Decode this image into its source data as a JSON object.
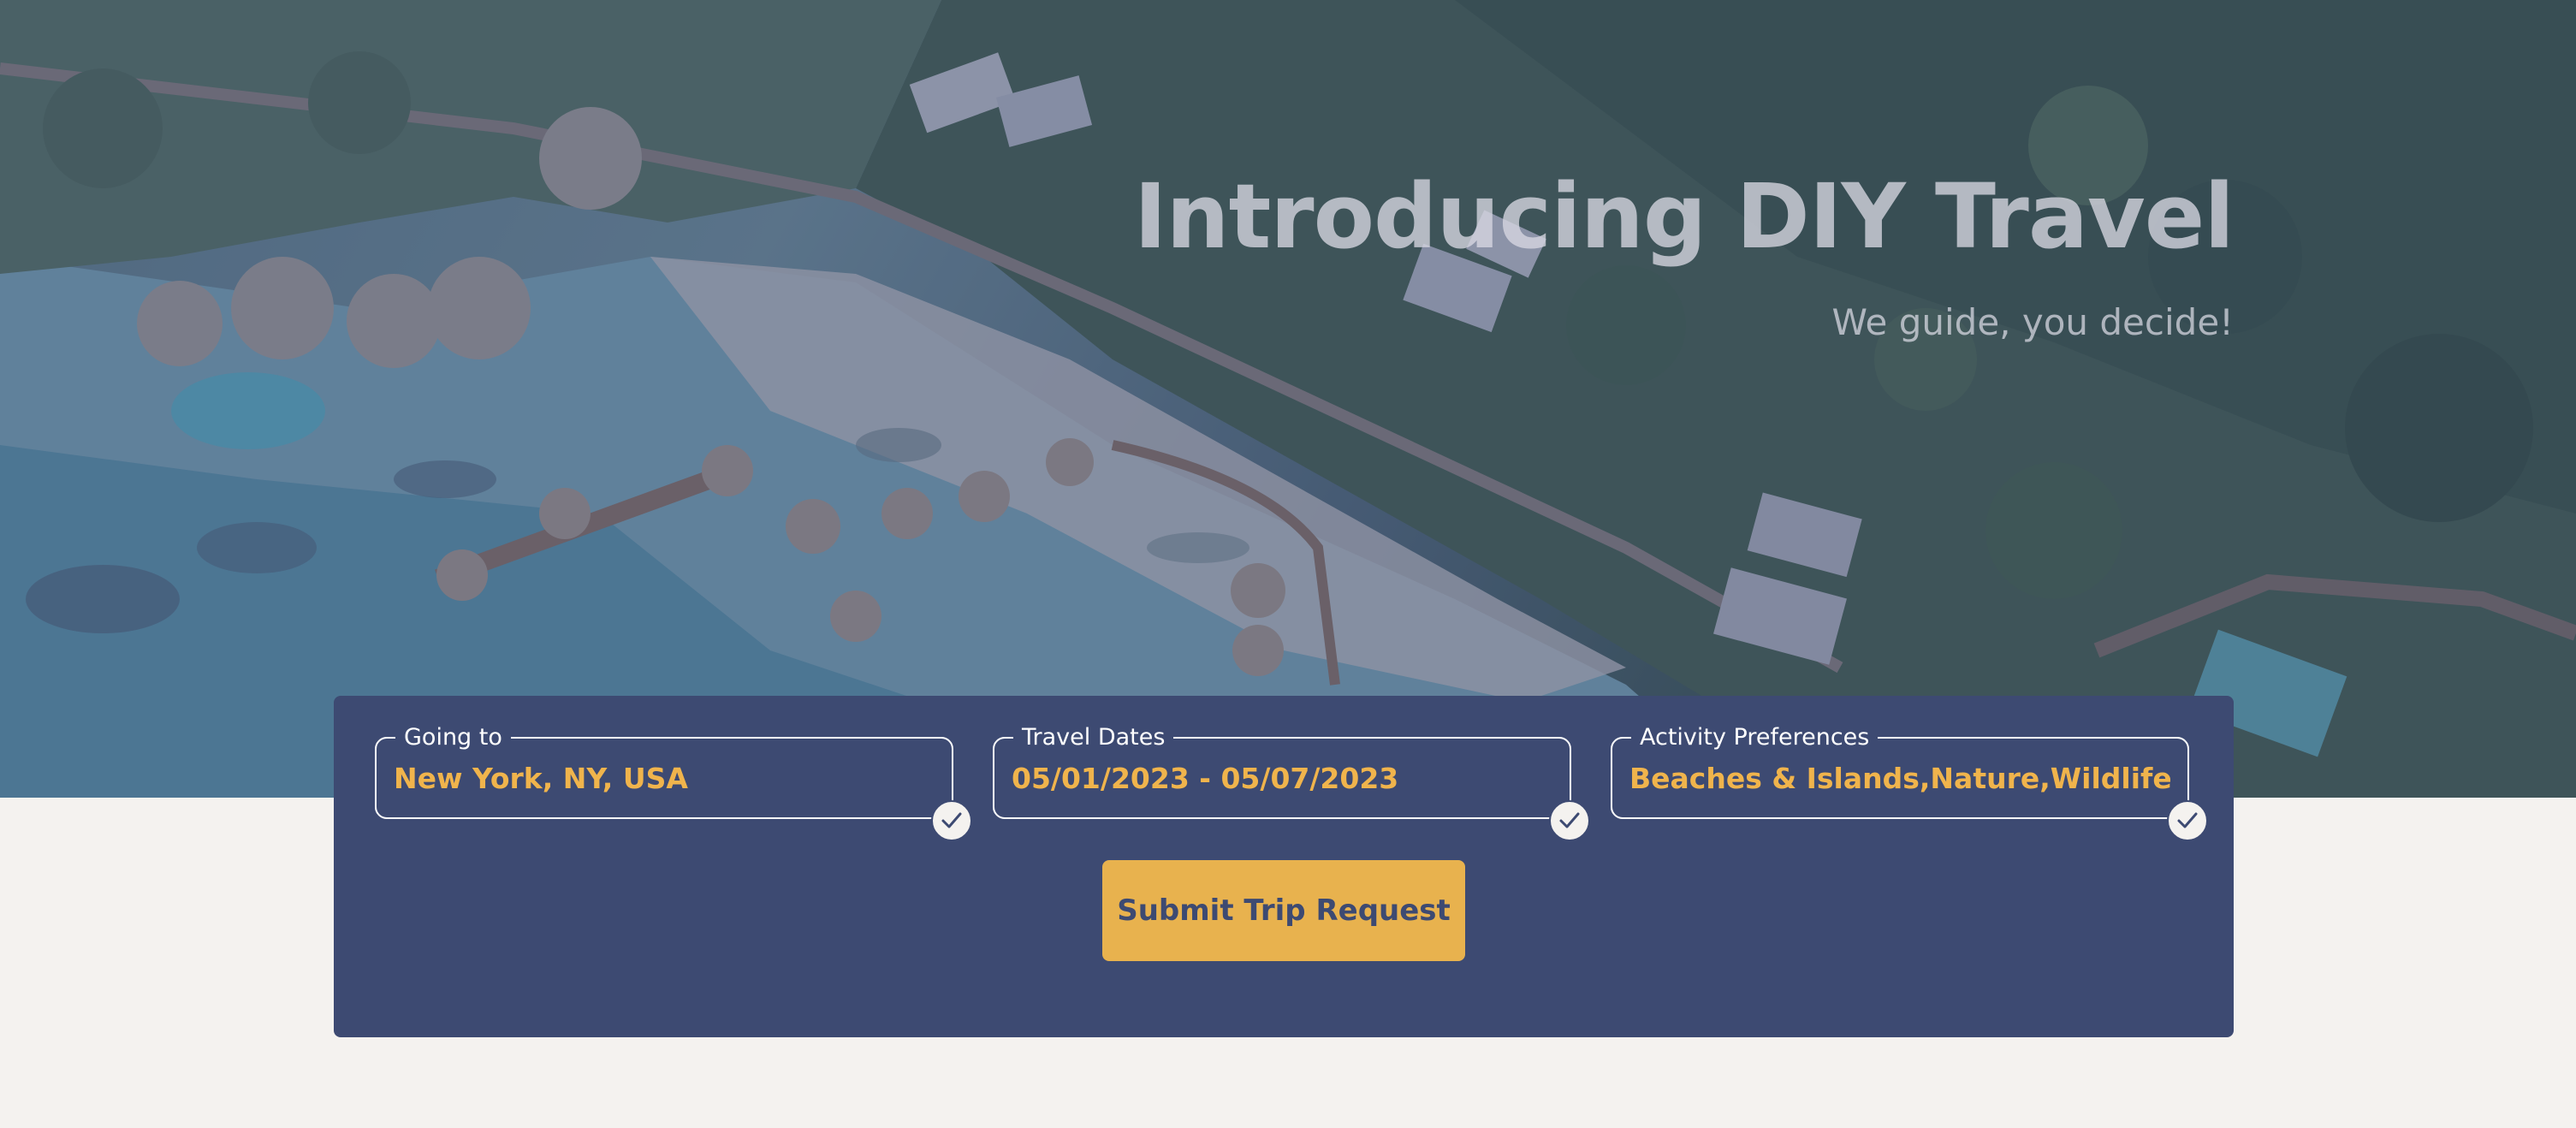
{
  "hero": {
    "title": "Introducing DIY Travel",
    "subtitle": "We guide, you decide!",
    "image_icon": "aerial-resort-photo"
  },
  "form": {
    "fields": [
      {
        "label": "Going to",
        "value": "New York, NY, USA",
        "icon": "check-icon"
      },
      {
        "label": "Travel Dates",
        "value": "05/01/2023 - 05/07/2023",
        "icon": "check-icon"
      },
      {
        "label": "Activity Preferences",
        "value": "Beaches & Islands,Nature,Wildlife,Arts &",
        "icon": "check-icon"
      }
    ],
    "submit_label": "Submit Trip Request"
  },
  "colors": {
    "panel": "#3d4a72",
    "accent": "#e8b24e",
    "value_text": "#f0b44c",
    "page_background": "#f4f2ef"
  }
}
